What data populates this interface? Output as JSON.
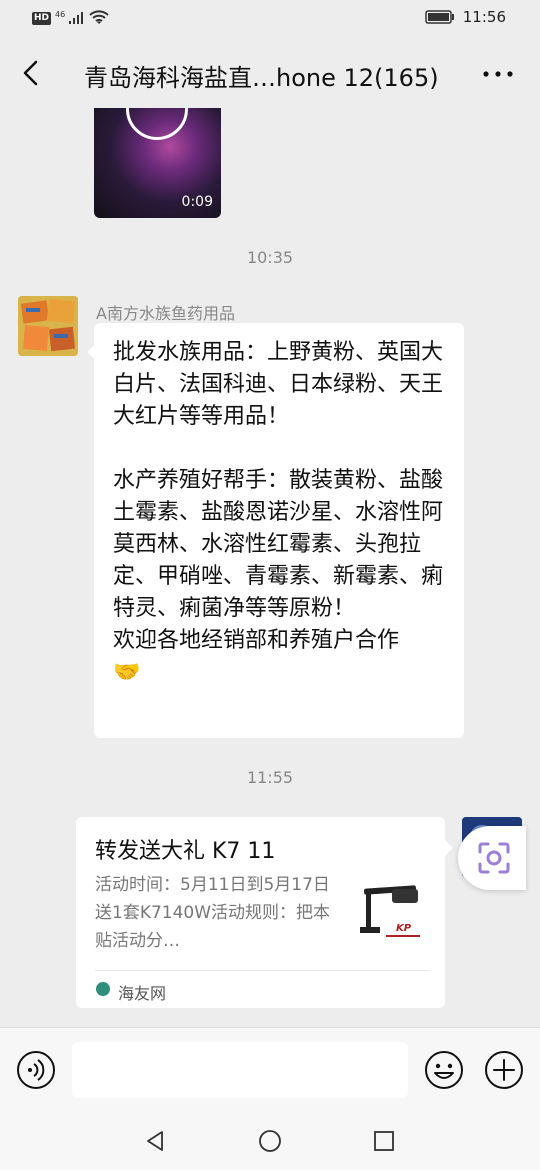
{
  "status_bar": {
    "hd": "HD",
    "network": "46",
    "time": "11:56"
  },
  "header": {
    "title": "青岛海科海盐直…hone 12(165)"
  },
  "video": {
    "duration": "0:09"
  },
  "timestamps": [
    "10:35",
    "11:55"
  ],
  "message": {
    "sender": "A南方水族鱼药用品",
    "text": "批发水族用品：上野黄粉、英国大白片、法国科迪、日本绿粉、天王大红片等等用品！\n\n水产养殖好帮手：散装黄粉、盐酸土霉素、盐酸恩诺沙星、水溶性阿莫西林、水溶性红霉素、头孢拉定、甲硝唑、青霉素、新霉素、痢特灵、痢菌净等等原粉！\n欢迎各地经销部和养殖户合作\n🤝"
  },
  "link_card": {
    "title": "转发送大礼 K7 11",
    "description": "活动时间：5月11日到5月17日送1套K7140W活动规则：把本贴活动分…",
    "source": "海友网"
  },
  "input": {
    "placeholder": ""
  },
  "icons": {
    "back": "chevron-left-icon",
    "more": "more-horizontal-icon",
    "voice": "voice-icon",
    "emoji": "emoji-icon",
    "plus": "plus-icon",
    "lens": "scan-lens-icon"
  },
  "colors": {
    "background": "#ededed",
    "bubble": "#ffffff",
    "lens": "#9b7fd6",
    "source": "#2f8f7a"
  }
}
